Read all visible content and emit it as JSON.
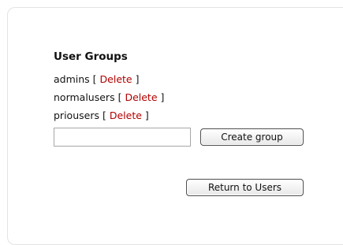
{
  "section": {
    "title": "User Groups"
  },
  "groups": [
    {
      "name": "admins",
      "open_bracket": "[",
      "delete_label": "Delete",
      "close_bracket": "]"
    },
    {
      "name": "normalusers",
      "open_bracket": "[",
      "delete_label": "Delete",
      "close_bracket": "]"
    },
    {
      "name": "priousers",
      "open_bracket": "[",
      "delete_label": "Delete",
      "close_bracket": "]"
    }
  ],
  "create_form": {
    "input_value": "",
    "button_label": "Create group"
  },
  "return_button_label": "Return to Users",
  "colors": {
    "delete_link": "#b30000",
    "text": "#111111"
  }
}
